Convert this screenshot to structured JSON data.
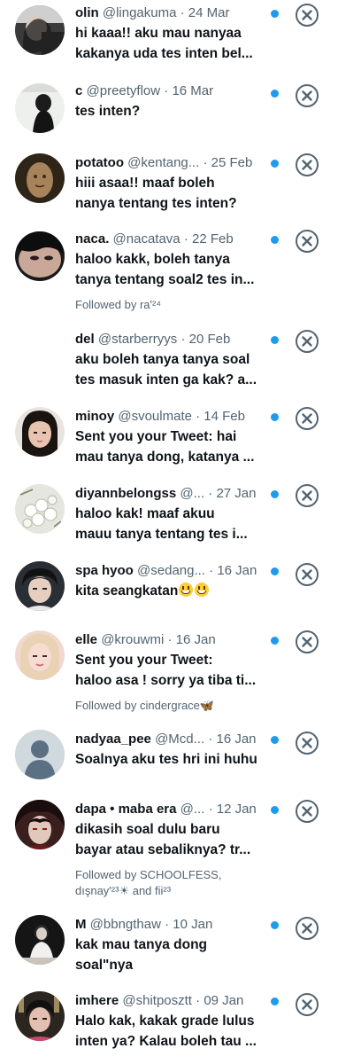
{
  "messages": [
    {
      "name": "olin",
      "handle": "@lingakuma",
      "date": "24 Mar",
      "lines": [
        "hi kaaa!! aku mau nanyaa",
        "kakanya uda tes inten bel..."
      ],
      "followed": ""
    },
    {
      "name": "c",
      "handle": "@preetyflow",
      "date": "16 Mar",
      "lines": [
        "tes inten?"
      ],
      "followed": ""
    },
    {
      "name": "potatoo",
      "handle": "@kentang...",
      "date": "25 Feb",
      "lines": [
        "hiii asaa!! maaf boleh",
        "nanya tentang tes inten?"
      ],
      "followed": ""
    },
    {
      "name": "naca.",
      "handle": "@nacatava",
      "date": "22 Feb",
      "lines": [
        "haloo kakk, boleh tanya",
        "tanya tentang soal2 tes in..."
      ],
      "followed": "Followed by ra'²⁴"
    },
    {
      "name": "del",
      "handle": "@starberryys",
      "date": "20 Feb",
      "lines": [
        "aku boleh tanya tanya soal",
        "tes masuk inten ga kak? a..."
      ],
      "followed": ""
    },
    {
      "name": "minoy",
      "handle": "@svoulmate",
      "date": "14 Feb",
      "lines": [
        "Sent you your Tweet: hai",
        "mau tanya dong, katanya ..."
      ],
      "followed": ""
    },
    {
      "name": "diyannbelongss",
      "handle": "@...",
      "date": "27 Jan",
      "lines": [
        "haloo kak! maaf akuu",
        "mauu tanya tentang tes i..."
      ],
      "followed": ""
    },
    {
      "name": "spa hyoo",
      "handle": "@sedang...",
      "date": "16 Jan",
      "lines": [
        "kita seangkatan"
      ],
      "followed": ""
    },
    {
      "name": "elle",
      "handle": "@krouwmi",
      "date": "16 Jan",
      "lines": [
        "Sent you your Tweet:",
        "haloo asa ! sorry ya tiba ti..."
      ],
      "followed": "Followed by cindergrace🦋"
    },
    {
      "name": "nadyaa_pee",
      "handle": "@Mcd...",
      "date": "16 Jan",
      "lines": [
        "Soalnya aku tes hri ini huhu"
      ],
      "followed": ""
    },
    {
      "name": "dapa • maba era",
      "handle": "@...",
      "date": "12 Jan",
      "lines": [
        "dikasih soal dulu baru",
        "bayar atau sebaliknya? tr..."
      ],
      "followed": "Followed by SCHOOLFESS, dışnaу'²³☀ and fii²³"
    },
    {
      "name": "M",
      "handle": "@bbngthaw",
      "date": "10 Jan",
      "lines": [
        "kak mau tanya dong",
        "soal\"nya"
      ],
      "followed": ""
    },
    {
      "name": "imhere",
      "handle": "@shitposztt",
      "date": "09 Jan",
      "lines": [
        "Halo kak, kakak grade lulus",
        "inten ya? Kalau boleh tau ..."
      ],
      "followed": ""
    }
  ],
  "separator": "·",
  "colors": {
    "unread_dot": "#1d9bf0",
    "secondary_text": "#536471",
    "primary_text": "#0f1419"
  },
  "icons": {
    "dismiss": "close-icon",
    "unread": "unread-dot-icon",
    "default_avatar": "default-avatar-icon"
  }
}
